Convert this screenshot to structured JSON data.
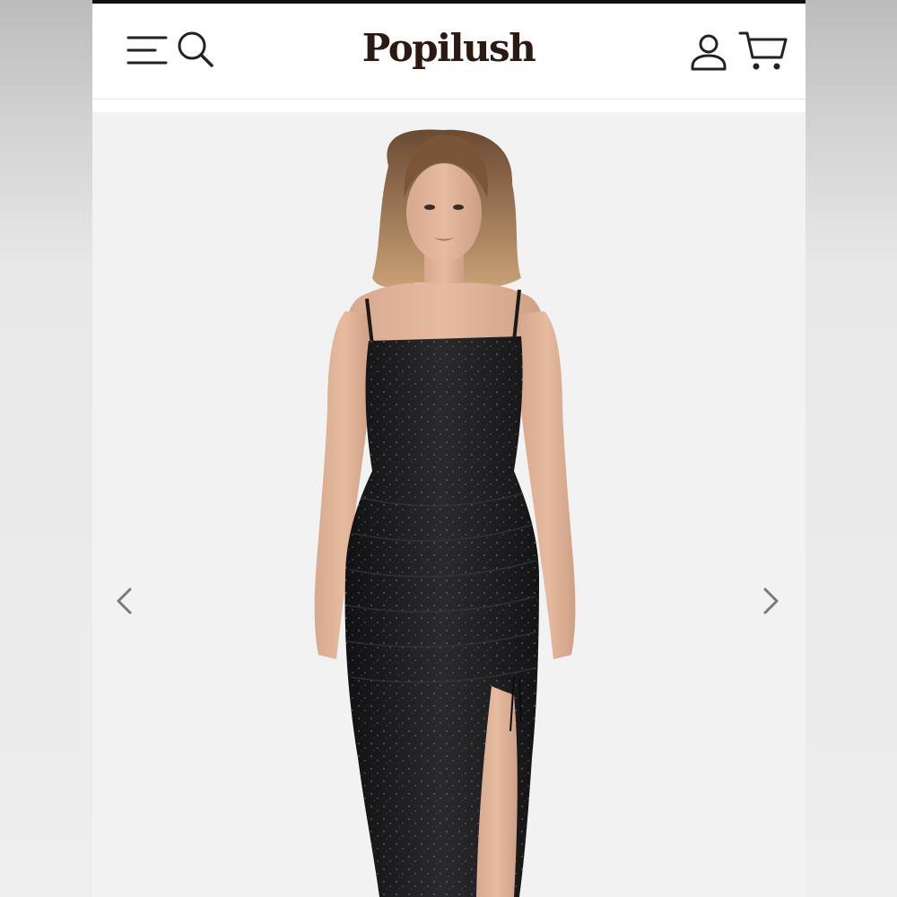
{
  "header": {
    "brand": "Popilush"
  },
  "icons": {
    "menu": "hamburger-menu-icon",
    "search": "search-icon",
    "account": "account-icon",
    "cart": "cart-icon",
    "prev": "chevron-left-icon",
    "next": "chevron-right-icon"
  },
  "colors": {
    "brand_text": "#2b1a12",
    "header_bg": "#ffffff",
    "gallery_bg": "#f2f2f2",
    "dress": "#1c1c1e",
    "icon": "#222222",
    "arrow": "#7a7a7a"
  },
  "gallery": {
    "image_subject": "product-photo"
  }
}
